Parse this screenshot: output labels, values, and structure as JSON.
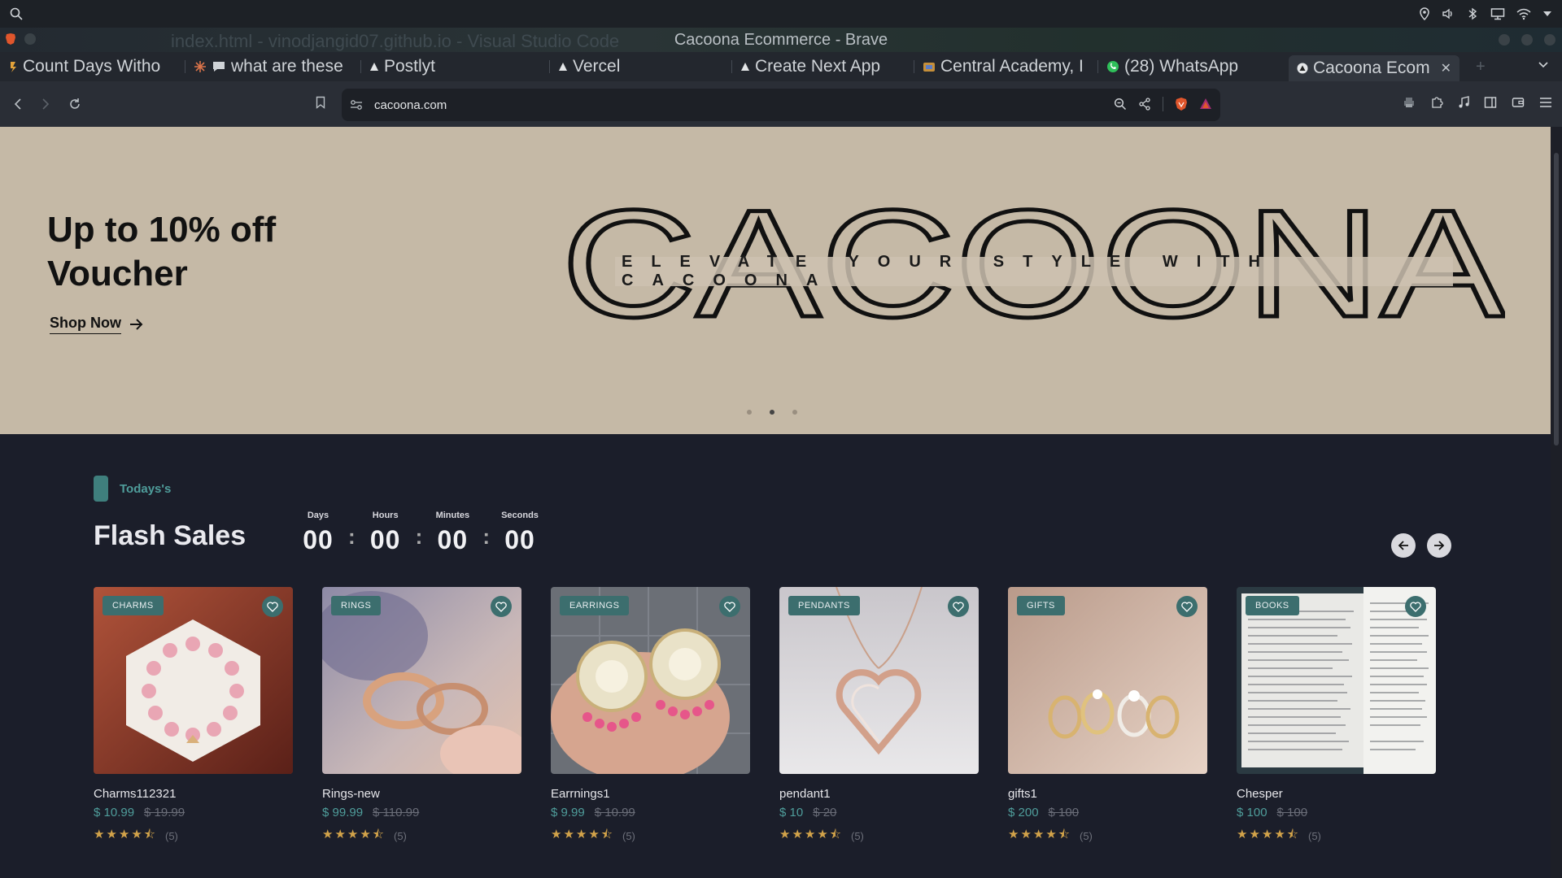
{
  "window": {
    "title": "Cacoona Ecommerce - Brave",
    "background_title": "index.html - vinodjangid07.github.io - Visual Studio Code"
  },
  "tabs": [
    {
      "label": "Count Days Witho",
      "icon": "counter-icon"
    },
    {
      "label": "what are these",
      "icon": "chat-icon"
    },
    {
      "label": "Postlyt",
      "icon": "vercel-icon"
    },
    {
      "label": "Vercel",
      "icon": "vercel-icon"
    },
    {
      "label": "Create Next App",
      "icon": "vercel-icon"
    },
    {
      "label": "Central Academy, I",
      "icon": "school-icon"
    },
    {
      "label": "(28) WhatsApp",
      "icon": "whatsapp-icon"
    },
    {
      "label": "Cacoona Ecomm",
      "icon": "vercel-icon",
      "active": true
    }
  ],
  "address": {
    "url": "cacoona.com"
  },
  "hero": {
    "title_line1": "Up to 10% off",
    "title_line2": "Voucher",
    "cta": "Shop Now",
    "brand": "CACOONA",
    "tagline": "ELEVATE YOUR STYLE WITH CACOONA",
    "slides": 3,
    "active_slide": 2
  },
  "flash": {
    "section_label": "Todays's",
    "title": "Flash Sales",
    "countdown": [
      {
        "unit": "Days",
        "value": "00"
      },
      {
        "unit": "Hours",
        "value": "00"
      },
      {
        "unit": "Minutes",
        "value": "00"
      },
      {
        "unit": "Seconds",
        "value": "00"
      }
    ]
  },
  "products": [
    {
      "badge": "CHARMS",
      "name": "Charms112321",
      "price": "$ 10.99",
      "old_price": "$ 19.99",
      "rating": 4.5,
      "reviews": "(5)",
      "image": "bracelet"
    },
    {
      "badge": "RINGS",
      "name": "Rings-new",
      "price": "$ 99.99",
      "old_price": "$ 110.99",
      "rating": 4.5,
      "reviews": "(5)",
      "image": "rings"
    },
    {
      "badge": "EARRINGS",
      "name": "Earrnings1",
      "price": "$ 9.99",
      "old_price": "$ 10.99",
      "rating": 4.5,
      "reviews": "(5)",
      "image": "earrings"
    },
    {
      "badge": "PENDANTS",
      "name": "pendant1",
      "price": "$ 10",
      "old_price": "$ 20",
      "rating": 4.5,
      "reviews": "(5)",
      "image": "pendant"
    },
    {
      "badge": "GIFTS",
      "name": "gifts1",
      "price": "$ 200",
      "old_price": "$ 100",
      "rating": 4.5,
      "reviews": "(5)",
      "image": "gift-rings"
    },
    {
      "badge": "BOOKS",
      "name": "Chesper",
      "price": "$ 100",
      "old_price": "$ 100",
      "rating": 4.5,
      "reviews": "(5)",
      "image": "documents"
    }
  ],
  "colors": {
    "accent": "#4f9d9b",
    "badge": "#3c6e6e",
    "hero_bg": "#c5b9a6",
    "page_bg": "#1b1e2a",
    "stars": "#d2a34a"
  }
}
